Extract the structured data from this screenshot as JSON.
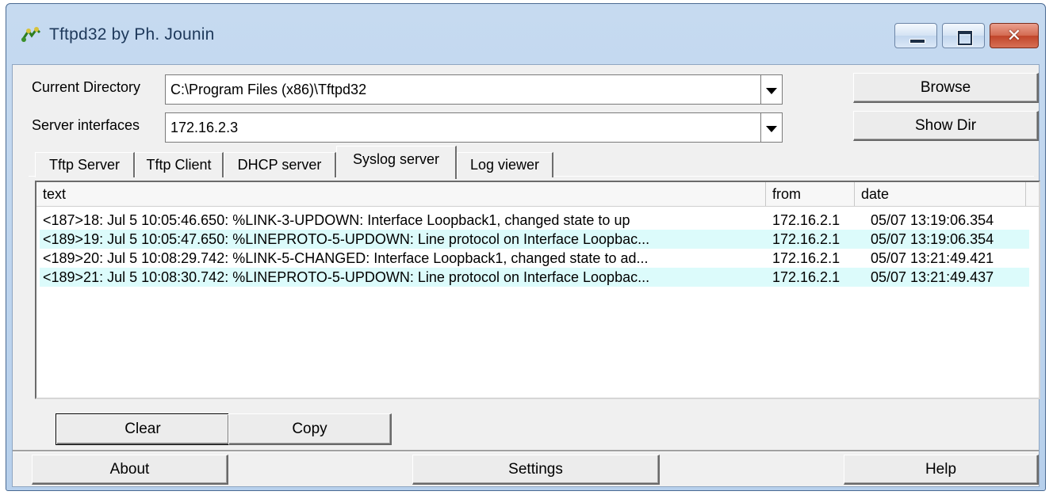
{
  "window": {
    "title": "Tftpd32 by Ph. Jounin",
    "icon": "tftpd32-app-icon"
  },
  "top": {
    "current_directory_label": "Current Directory",
    "current_directory_value": "C:\\Program Files (x86)\\Tftpd32",
    "server_interfaces_label": "Server interfaces",
    "server_interfaces_value": "172.16.2.3",
    "browse_label": "Browse",
    "show_dir_label": "Show Dir"
  },
  "tabs": [
    {
      "label": "Tftp Server",
      "active": false
    },
    {
      "label": "Tftp Client",
      "active": false
    },
    {
      "label": "DHCP server",
      "active": false
    },
    {
      "label": "Syslog server",
      "active": true
    },
    {
      "label": "Log viewer",
      "active": false
    }
  ],
  "syslog": {
    "columns": [
      "text",
      "from",
      "date"
    ],
    "rows": [
      {
        "text": "<187>18: Jul  5 10:05:46.650: %LINK-3-UPDOWN: Interface Loopback1, changed state to up",
        "from": "172.16.2.1",
        "date": "05/07 13:19:06.354"
      },
      {
        "text": "<189>19: Jul  5 10:05:47.650: %LINEPROTO-5-UPDOWN: Line protocol on Interface Loopbac...",
        "from": "172.16.2.1",
        "date": "05/07 13:19:06.354"
      },
      {
        "text": "<189>20: Jul  5 10:08:29.742: %LINK-5-CHANGED: Interface Loopback1, changed state to ad...",
        "from": "172.16.2.1",
        "date": "05/07 13:21:49.421"
      },
      {
        "text": "<189>21: Jul  5 10:08:30.742: %LINEPROTO-5-UPDOWN: Line protocol on Interface Loopbac...",
        "from": "172.16.2.1",
        "date": "05/07 13:21:49.437"
      }
    ],
    "clear_label": "Clear",
    "copy_label": "Copy"
  },
  "bottom": {
    "about_label": "About",
    "settings_label": "Settings",
    "help_label": "Help"
  },
  "colors": {
    "titlebar": "#c6daf0",
    "alt_row": "#dcfbfb",
    "close_button": "#c7482c"
  }
}
